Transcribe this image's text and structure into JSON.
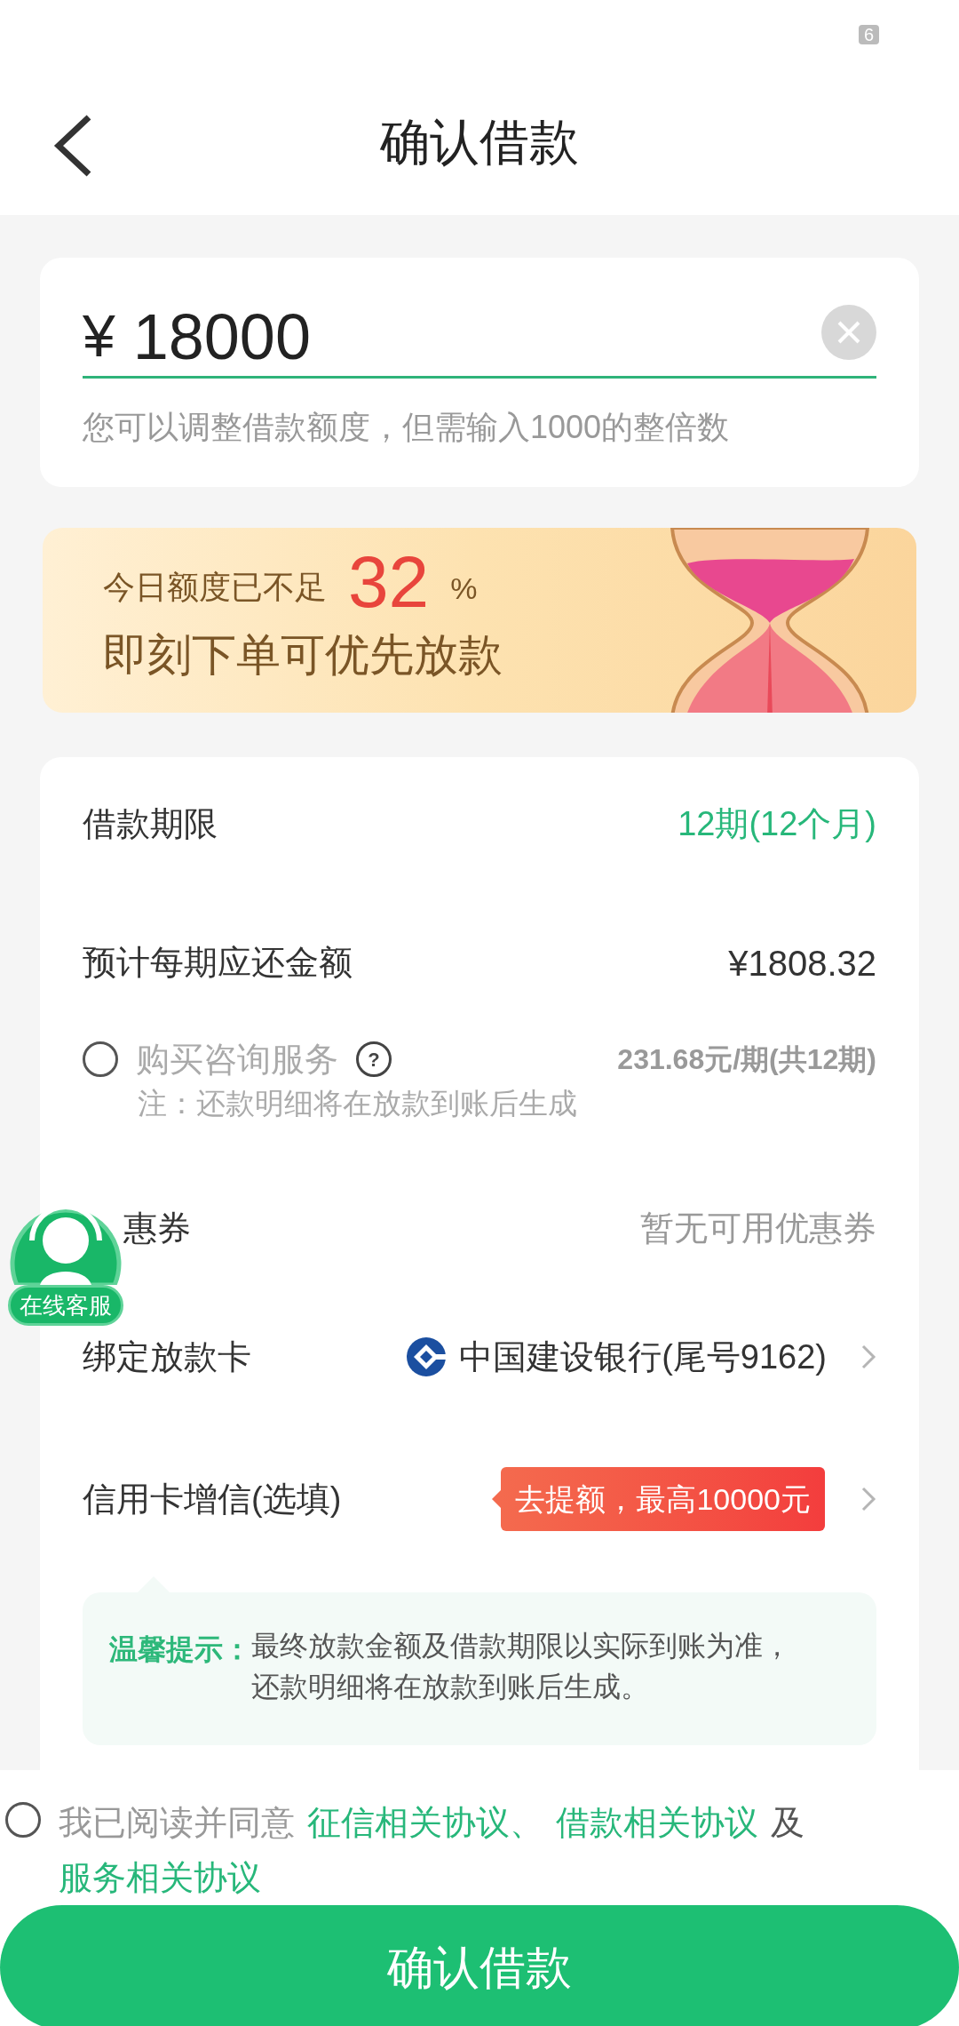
{
  "status_bar": {
    "battery": "6"
  },
  "header": {
    "title": "确认借款"
  },
  "amount": {
    "currency": "¥",
    "value": "18000",
    "hint": "您可以调整借款额度，但需输入1000的整倍数"
  },
  "banner": {
    "line1": "今日额度已不足",
    "percent": "32",
    "percent_sign": "%",
    "line2": "即刻下单可优先放款"
  },
  "details": [
    {
      "kind": "term",
      "label": "借款期限",
      "value": "12期(12个月)"
    },
    {
      "kind": "amount",
      "label": "预计每期应还金额",
      "value": "¥1808.32"
    },
    {
      "kind": "service",
      "label": "购买咨询服务",
      "checked": false,
      "help": "?",
      "price": "231.68元/期(共12期)",
      "note": "注：还款明细将在放款到账后生成"
    },
    {
      "kind": "coupon",
      "label": "惠券",
      "value": "暂无可用优惠券"
    },
    {
      "kind": "bank",
      "label": "绑定放款卡",
      "value": "中国建设银行(尾号9162)"
    },
    {
      "kind": "credit",
      "label": "信用卡增信(选填)",
      "value": "去提额，最高10000元"
    }
  ],
  "tip": {
    "title": "温馨提示：",
    "lines": [
      "最终放款金额及借款期限以实际到账为准，",
      "还款明细将在放款到账后生成。"
    ]
  },
  "agreement": {
    "checked": false,
    "parts": [
      {
        "kind": "text",
        "text": "我已阅读并同意"
      },
      {
        "kind": "link",
        "text": "征信相关协议、"
      },
      {
        "kind": "link",
        "text": "借款相关协议"
      },
      {
        "kind": "text",
        "text": "及"
      },
      {
        "kind": "link",
        "text": "服务相关协议"
      }
    ]
  },
  "float_button": {
    "label": "在线客服"
  },
  "submit": {
    "label": "确认借款"
  }
}
